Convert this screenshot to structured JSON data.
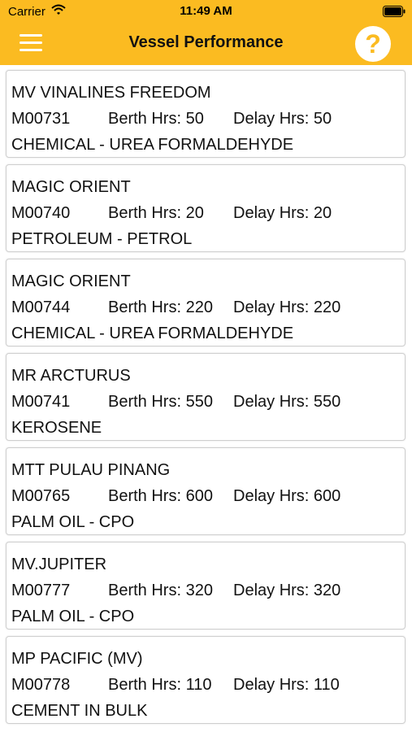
{
  "status_bar": {
    "carrier": "Carrier",
    "time": "11:49 AM",
    "wifi_icon": "wifi-icon",
    "battery_icon": "battery-icon"
  },
  "nav": {
    "title": "Vessel Performance",
    "menu_icon": "hamburger-menu-icon",
    "help_label": "?",
    "accent_color": "#fbbb21"
  },
  "vessels": [
    {
      "name": "MV VINALINES FREEDOM",
      "code": "M00731",
      "berth": "Berth Hrs: 50",
      "delay": "Delay Hrs: 50",
      "cargo": "CHEMICAL - UREA FORMALDEHYDE"
    },
    {
      "name": "MAGIC ORIENT",
      "code": "M00740",
      "berth": "Berth Hrs: 20",
      "delay": "Delay Hrs: 20",
      "cargo": "PETROLEUM - PETROL"
    },
    {
      "name": "MAGIC ORIENT",
      "code": "M00744",
      "berth": "Berth Hrs: 220",
      "delay": "Delay Hrs: 220",
      "cargo": "CHEMICAL - UREA FORMALDEHYDE"
    },
    {
      "name": "MR ARCTURUS",
      "code": "M00741",
      "berth": "Berth Hrs: 550",
      "delay": "Delay Hrs: 550",
      "cargo": "KEROSENE"
    },
    {
      "name": "MTT PULAU PINANG",
      "code": "M00765",
      "berth": "Berth Hrs: 600",
      "delay": "Delay Hrs: 600",
      "cargo": "PALM OIL - CPO"
    },
    {
      "name": "MV.JUPITER",
      "code": "M00777",
      "berth": "Berth Hrs: 320",
      "delay": "Delay Hrs: 320",
      "cargo": "PALM OIL - CPO"
    },
    {
      "name": "MP PACIFIC (MV)",
      "code": "M00778",
      "berth": "Berth Hrs: 110",
      "delay": "Delay Hrs: 110",
      "cargo": "CEMENT IN BULK"
    }
  ]
}
